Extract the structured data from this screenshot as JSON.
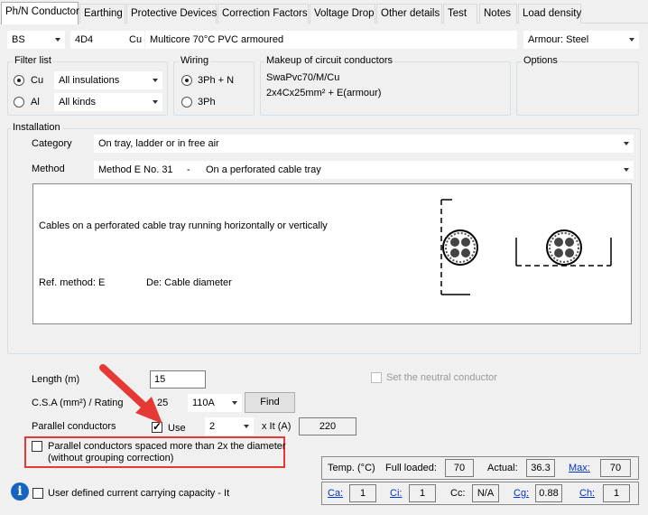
{
  "tabs": [
    "Ph/N Conductor",
    "Earthing",
    "Protective Devices",
    "Correction Factors",
    "Voltage Drop",
    "Other details",
    "Test",
    "Notes",
    "Load density"
  ],
  "top": {
    "standard": "BS",
    "cable_ref": "4D4",
    "material": "Cu",
    "cable_desc": "Multicore 70°C PVC armoured",
    "armour": "Armour: Steel"
  },
  "filter": {
    "title": "Filter list",
    "opt_cu": "Cu",
    "opt_al": "Al",
    "insulations": "All insulations",
    "kinds": "All kinds"
  },
  "wiring": {
    "title": "Wiring",
    "opt1": "3Ph + N",
    "opt2": "3Ph"
  },
  "makeup": {
    "title": "Makeup of circuit conductors",
    "line1": "SwaPvc70/M/Cu",
    "line2": "2x4Cx25mm² + E(armour)"
  },
  "options": {
    "title": "Options"
  },
  "installation": {
    "title": "Installation",
    "category_label": "Category",
    "category_value": "On tray, ladder or in free air",
    "method_label": "Method",
    "method_code": "Method E No. 31",
    "method_dash": "-",
    "method_value": "On a perforated cable tray",
    "desc": "Cables on a perforated cable tray running horizontally or vertically",
    "ref": "Ref. method: E",
    "de": "De: Cable diameter"
  },
  "form": {
    "length_label": "Length (m)",
    "length_value": "15",
    "csa_label": "C.S.A (mm²) / Rating",
    "csa_value": "25",
    "rating_value": "110A",
    "find": "Find",
    "parallel_label": "Parallel conductors",
    "use": "Use",
    "parallel_count": "2",
    "xit_label": "x It (A)",
    "xit_value": "220",
    "neutral": "Set the neutral conductor",
    "spaced1": "Parallel conductors spaced more than 2x the diameter",
    "spaced2": "(without grouping correction)",
    "user_defined": "User defined current carrying capacity - It"
  },
  "temp": {
    "label": "Temp. (°C)",
    "full_label": "Full loaded:",
    "full_value": "70",
    "actual_label": "Actual:",
    "actual_value": "36.3",
    "max_label": "Max:",
    "max_value": "70"
  },
  "factors": {
    "ca_label": "Ca:",
    "ca": "1",
    "ci_label": "Ci:",
    "ci": "1",
    "cc_label": "Cc:",
    "cc": "N/A",
    "cg_label": "Cg:",
    "cg": "0.88",
    "ch_label": "Ch:",
    "ch": "1"
  },
  "colors": {
    "highlight": "#e53935",
    "arrow": "#e53935",
    "link": "#0033cc",
    "info": "#1565c0"
  }
}
